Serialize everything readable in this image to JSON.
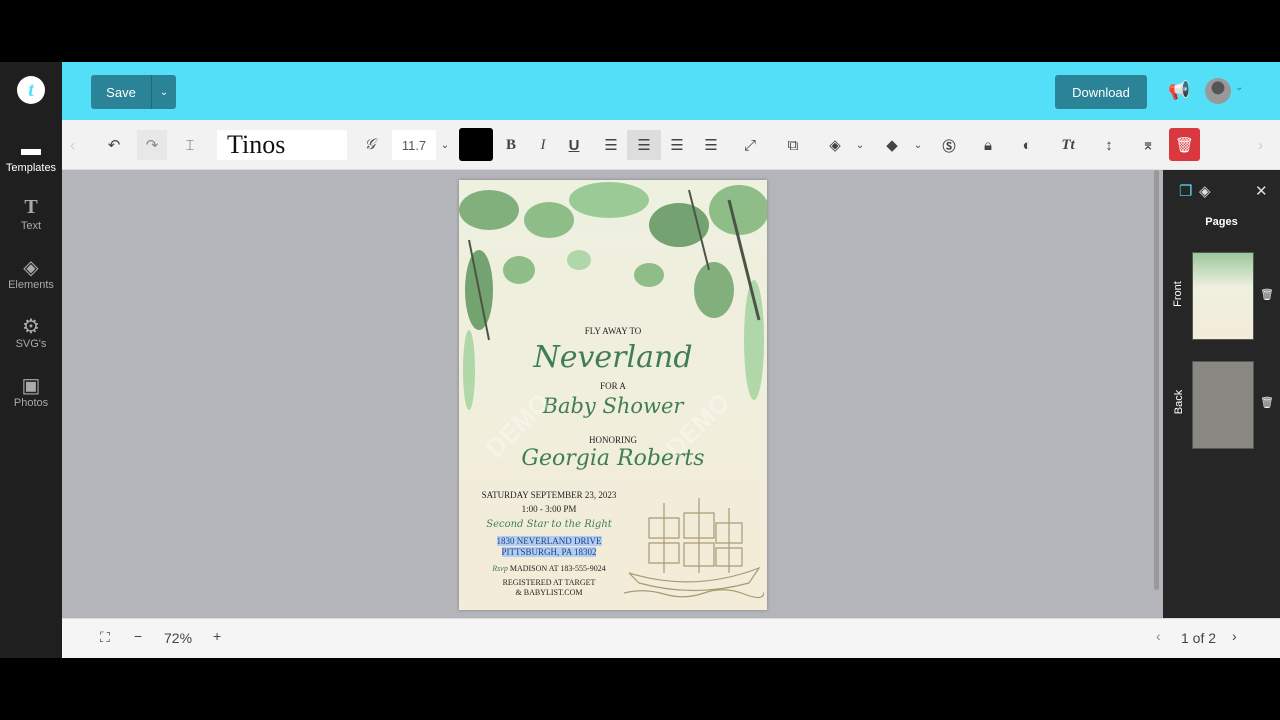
{
  "sidebar": {
    "items": [
      {
        "label": "Templates",
        "icon": "layers"
      },
      {
        "label": "Text",
        "icon": "T"
      },
      {
        "label": "Elements",
        "icon": "cube"
      },
      {
        "label": "SVG's",
        "icon": "gear"
      },
      {
        "label": "Photos",
        "icon": "image"
      }
    ]
  },
  "header": {
    "save_label": "Save",
    "download_label": "Download"
  },
  "toolbar": {
    "font": "Tinos",
    "font_size": "11.7",
    "text_color": "#000000",
    "bold": "B",
    "italic": "I",
    "underline": "U",
    "text_style": "Tt"
  },
  "document": {
    "line1": "FLY AWAY TO",
    "line2": "Neverland",
    "line3": "FOR A",
    "line4": "Baby Shower",
    "line5": "HONORING",
    "line6": "Georgia Roberts",
    "date": "SATURDAY SEPTEMBER 23, 2023",
    "time": "1:00 - 3:00 PM",
    "location_script": "Second Star to the Right",
    "address1": "1830 NEVERLAND DRIVE",
    "address2": "PITTSBURGH, PA 18302",
    "rsvp_script": "Rsvp",
    "rsvp": "MADISON AT 183-555-9024",
    "registry1": "REGISTERED AT TARGET",
    "registry2": "& BABYLIST.COM",
    "watermark": "DEMO"
  },
  "panel": {
    "title": "Pages",
    "pages": [
      {
        "label": "Front"
      },
      {
        "label": "Back"
      }
    ]
  },
  "bottom": {
    "zoom": "72%",
    "page_indicator": "1 of 2"
  },
  "colors": {
    "header": "#52dff7",
    "button": "#2a8396",
    "delete": "#d9383f",
    "script_text": "#3f7e55"
  }
}
